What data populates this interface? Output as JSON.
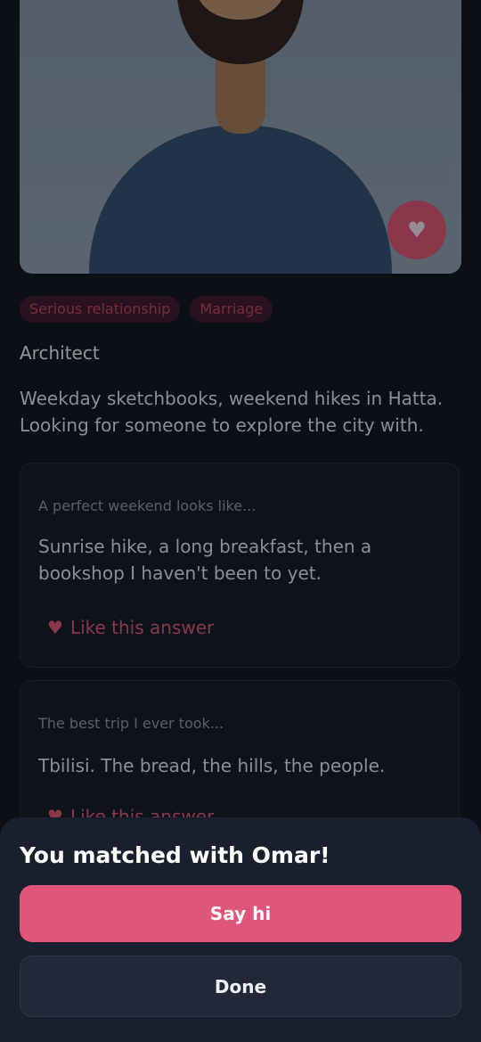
{
  "profile": {
    "like_photo_icon": "heart-icon",
    "intents": [
      "Serious relationship",
      "Marriage"
    ],
    "occupation": "Architect",
    "bio": "Weekday sketchbooks, weekend hikes in Hatta. Looking for someone to explore the city with."
  },
  "prompts": [
    {
      "question": "A perfect weekend looks like...",
      "answer": "Sunrise hike, a long breakfast, then a bookshop I haven't been to yet.",
      "like_label": "Like this answer"
    },
    {
      "question": "The best trip I ever took...",
      "answer": "Tbilisi. The bread, the hills, the people.",
      "like_label": "Like this answer"
    }
  ],
  "match_sheet": {
    "title": "You matched with Omar!",
    "primary_label": "Say hi",
    "secondary_label": "Done"
  },
  "colors": {
    "accent": "#e0567a",
    "background": "#0b0f16",
    "sheet": "#1a1f2d"
  }
}
